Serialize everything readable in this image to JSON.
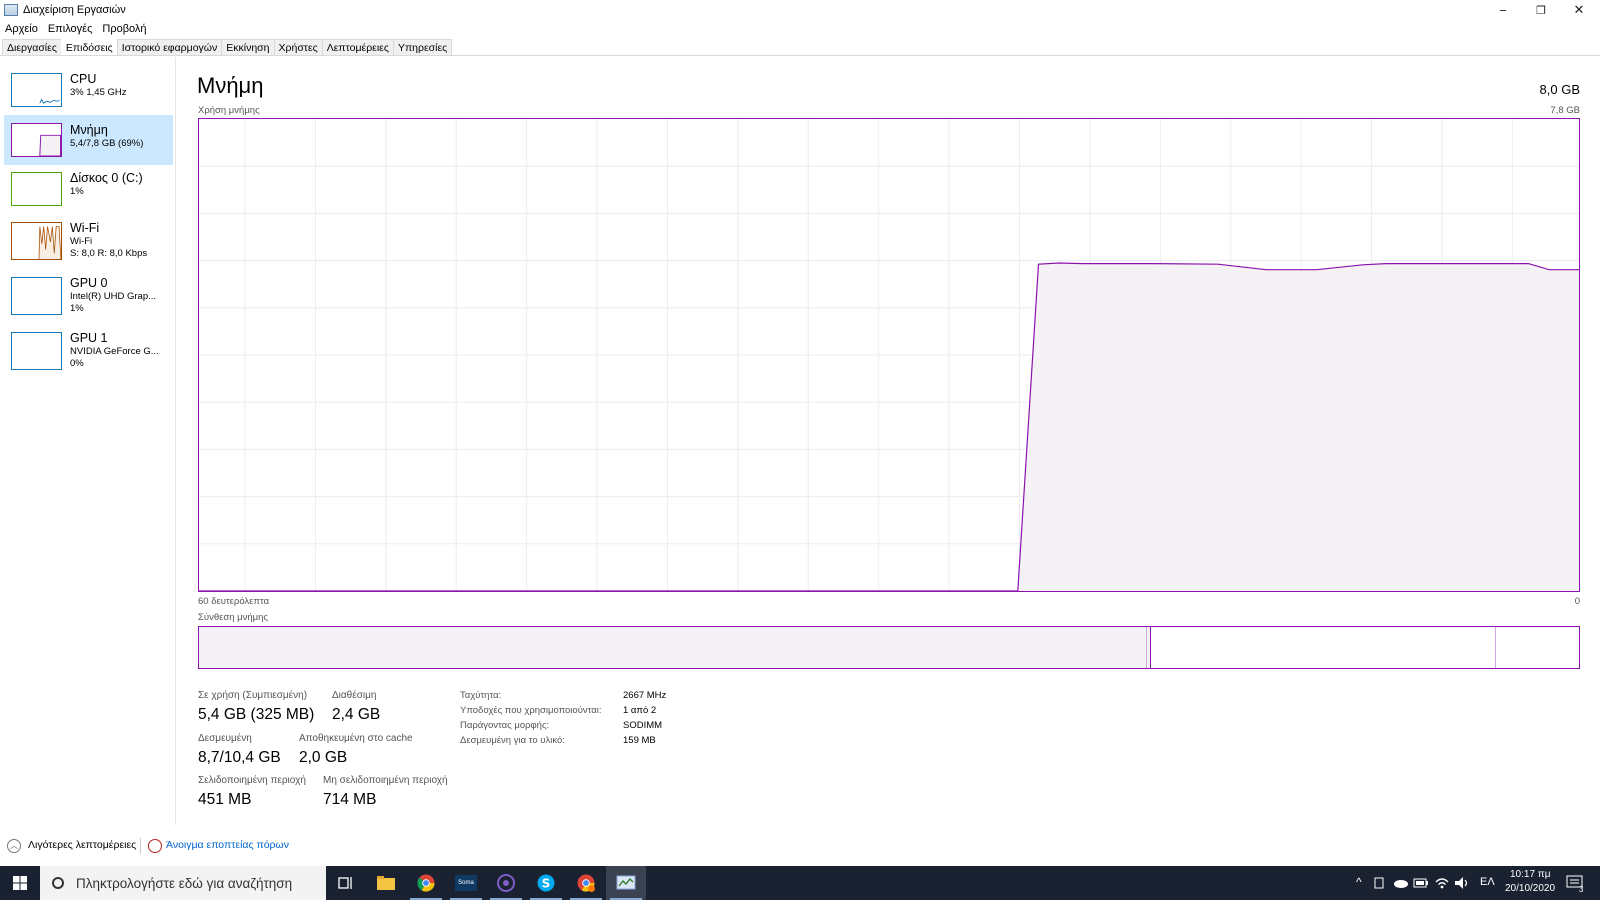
{
  "window": {
    "title": "Διαχείριση Εργασιών",
    "controls": {
      "minimize": "−",
      "restore": "❐",
      "close": "✕"
    }
  },
  "menu": [
    "Αρχείο",
    "Επιλογές",
    "Προβολή"
  ],
  "tabs": [
    {
      "label": "Διεργασίες",
      "active": false
    },
    {
      "label": "Επιδόσεις",
      "active": true
    },
    {
      "label": "Ιστορικό εφαρμογών",
      "active": false
    },
    {
      "label": "Εκκίνηση",
      "active": false
    },
    {
      "label": "Χρήστες",
      "active": false
    },
    {
      "label": "Λεπτομέρειες",
      "active": false
    },
    {
      "label": "Υπηρεσίες",
      "active": false
    }
  ],
  "sidebar": {
    "items": [
      {
        "name": "CPU",
        "lines": [
          "3%  1,45 GHz"
        ],
        "color": "#1779ba"
      },
      {
        "name": "Μνήμη",
        "lines": [
          "5,4/7,8 GB (69%)"
        ],
        "color": "#8b12ae"
      },
      {
        "name": "Δίσκος 0 (C:)",
        "lines": [
          "1%"
        ],
        "color": "#4da60c"
      },
      {
        "name": "Wi-Fi",
        "lines": [
          "Wi-Fi",
          "S: 8,0  R: 8,0 Kbps"
        ],
        "color": "#a74f01"
      },
      {
        "name": "GPU 0",
        "lines": [
          "Intel(R) UHD Grap...",
          "1%"
        ],
        "color": "#1779ba"
      },
      {
        "name": "GPU 1",
        "lines": [
          "NVIDIA GeForce G...",
          "0%"
        ],
        "color": "#1779ba"
      }
    ]
  },
  "main": {
    "title": "Μνήμη",
    "total": "8,0 GB",
    "usage_label": "Χρήση μνήμης",
    "usage_max": "7,8 GB",
    "time_left": "60 δευτερόλεπτα",
    "time_right": "0",
    "composition_label": "Σύνθεση μνήμης"
  },
  "chart_data": {
    "type": "area",
    "title": "Χρήση μνήμης",
    "x_label_left": "60 δευτερόλεπτα",
    "x_label_right": "0",
    "ylim": [
      0,
      7.8
    ],
    "y_unit": "GB",
    "x_seconds_ago": [
      60,
      24.4,
      23.5,
      22.6,
      21.6,
      18.4,
      15.7,
      13.6,
      11.4,
      9.4,
      8.4,
      7.2,
      5.1,
      2.2,
      1.3,
      0
    ],
    "values": [
      0,
      0,
      5.4,
      5.42,
      5.41,
      5.41,
      5.4,
      5.31,
      5.31,
      5.39,
      5.41,
      5.41,
      5.41,
      5.41,
      5.31,
      5.31
    ],
    "color": "#8b12ae",
    "fill": "#f4f2f4",
    "grid": true
  },
  "composition": {
    "in_use_fraction": 0.687,
    "modified_fraction": 0.003,
    "standby_fraction": 0.25,
    "free_fraction": 0.06
  },
  "stats": {
    "in_use_label": "Σε χρήση (Συμπιεσμένη)",
    "in_use_value": "5,4 GB (325 MB)",
    "available_label": "Διαθέσιμη",
    "available_value": "2,4 GB",
    "committed_label": "Δεσμευμένη",
    "committed_value": "8,7/10,4 GB",
    "cached_label": "Αποθηκευμένη στο cache",
    "cached_value": "2,0 GB",
    "paged_label": "Σελιδοποιημένη περιοχή",
    "paged_value": "451 MB",
    "nonpaged_label": "Μη σελιδοποιημένη περιοχή",
    "nonpaged_value": "714 MB"
  },
  "specs": {
    "speed_label": "Ταχύτητα:",
    "speed_value": "2667 MHz",
    "slots_label": "Υποδοχές που χρησιμοποιούνται:",
    "slots_value": "1 από 2",
    "form_label": "Παράγοντας μορφής:",
    "form_value": "SODIMM",
    "reserved_label": "Δεσμευμένη για το υλικό:",
    "reserved_value": "159 MB"
  },
  "footer": {
    "fewer_details": "Λιγότερες λεπτομέρειες",
    "open_monitor": "Άνοιγμα εποπτείας πόρων",
    "link_color": "#0066cc"
  },
  "taskbar": {
    "search_placeholder": "Πληκτρολογήστε εδώ για αναζήτηση",
    "soma_label": "Soma",
    "lang": "ΕΛ",
    "time": "10:17 πμ",
    "date": "20/10/2020",
    "notifications": "3",
    "bg": "#1a2130"
  }
}
